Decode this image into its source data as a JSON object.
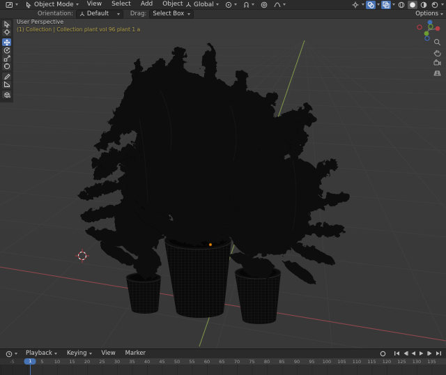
{
  "header": {
    "mode": "Object Mode",
    "menu_view": "View",
    "menu_select": "Select",
    "menu_add": "Add",
    "menu_object": "Object",
    "orientation": "Global",
    "options": "Options"
  },
  "tool_settings": {
    "orientation_label": "Orientation:",
    "orientation_value": "Default",
    "drag_label": "Drag:",
    "drag_value": "Select Box"
  },
  "viewport": {
    "view_label": "User Perspective",
    "breadcrumb": "(1) Collection | Collection plant vol 96 plant 1 a"
  },
  "timeline": {
    "menu_playback": "Playback",
    "menu_keying": "Keying",
    "menu_view": "View",
    "menu_marker": "Marker",
    "current_frame": "1",
    "tick_labels": [
      "-5",
      "0",
      "5",
      "10",
      "15",
      "20",
      "25",
      "30",
      "35",
      "40",
      "45",
      "50",
      "55",
      "60",
      "65",
      "70",
      "75",
      "80",
      "85",
      "90",
      "95",
      "100",
      "105",
      "110",
      "115",
      "120",
      "125",
      "130",
      "135"
    ]
  },
  "colors": {
    "accent_blue": "#4772b3",
    "axis_x_red": "#9e4a50",
    "axis_y_green": "#8aa24d",
    "selected_orange": "#e8850d",
    "breadcrumb_yellow": "#b3a14c"
  }
}
